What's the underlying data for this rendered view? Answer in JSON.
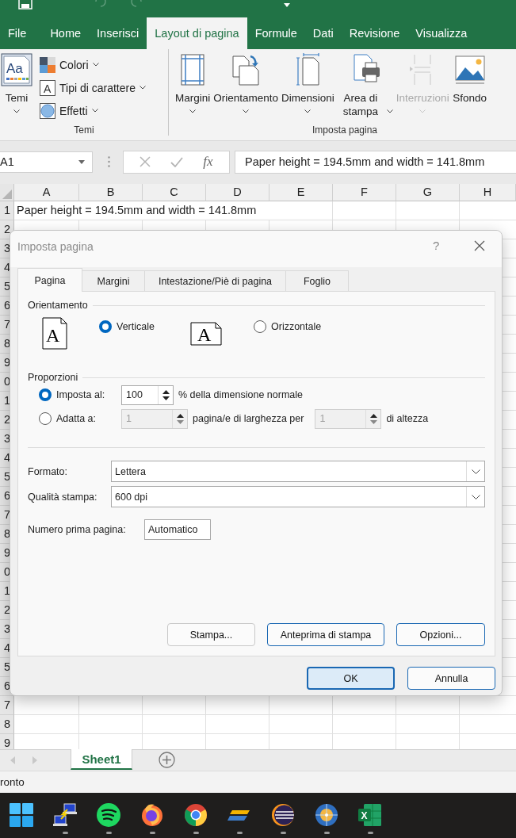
{
  "ribbon_tabs": [
    {
      "label": "File",
      "selected": false
    },
    {
      "label": "Home",
      "selected": false
    },
    {
      "label": "Inserisci",
      "selected": false
    },
    {
      "label": "Layout di pagina",
      "selected": true
    },
    {
      "label": "Formule",
      "selected": false
    },
    {
      "label": "Dati",
      "selected": false
    },
    {
      "label": "Revisione",
      "selected": false
    },
    {
      "label": "Visualizza",
      "selected": false
    }
  ],
  "ribbon": {
    "groups": [
      {
        "label": "Temi",
        "buttons": [
          {
            "label": "Temi",
            "kind": "large",
            "dropdown": true,
            "disabled": false,
            "glyph": "Aa"
          },
          {
            "label": "Colori",
            "kind": "small",
            "dropdown": true,
            "disabled": false
          },
          {
            "label": "Tipi di carattere",
            "kind": "small",
            "dropdown": true,
            "disabled": false,
            "glyph": "A"
          },
          {
            "label": "Effetti",
            "kind": "small",
            "dropdown": true,
            "disabled": false
          }
        ]
      },
      {
        "label": "Imposta pagina",
        "buttons": [
          {
            "label": "Margini",
            "kind": "large",
            "dropdown": true,
            "disabled": false
          },
          {
            "label": "Orientamento",
            "kind": "large",
            "dropdown": true,
            "disabled": false
          },
          {
            "label": "Dimensioni",
            "kind": "large",
            "dropdown": true,
            "disabled": false
          },
          {
            "label": "Area di stampa",
            "kind": "wrapped",
            "dropdown": true,
            "disabled": false
          },
          {
            "label": "Interruzioni",
            "kind": "large",
            "dropdown": true,
            "disabled": true
          },
          {
            "label": "Sfondo",
            "kind": "large",
            "dropdown": false,
            "disabled": false
          }
        ]
      }
    ]
  },
  "formula_bar": {
    "name_box": "A1",
    "function_glyph": "fx",
    "formula": "Paper height = 194.5mm and width = 141.8mm"
  },
  "sheet": {
    "columns": [
      "A",
      "B",
      "C",
      "D",
      "E",
      "F",
      "G",
      "H"
    ],
    "rows": [
      {
        "header": "1",
        "text": "Paper height = 194.5mm and width = 141.8mm"
      },
      {
        "header": "2"
      },
      {
        "header": "3"
      },
      {
        "header": "4"
      },
      {
        "header": "5"
      },
      {
        "header": "6"
      },
      {
        "header": "7"
      },
      {
        "header": "8"
      },
      {
        "header": "9"
      },
      {
        "header": "0"
      },
      {
        "header": "1"
      },
      {
        "header": "2"
      },
      {
        "header": "3"
      },
      {
        "header": "4"
      },
      {
        "header": "5"
      },
      {
        "header": "6"
      },
      {
        "header": "7"
      },
      {
        "header": "8"
      },
      {
        "header": "9"
      },
      {
        "header": "0"
      },
      {
        "header": "1"
      },
      {
        "header": "2"
      },
      {
        "header": "3"
      },
      {
        "header": "4"
      },
      {
        "header": "5"
      },
      {
        "header": "6"
      },
      {
        "header": "7"
      },
      {
        "header": "8"
      },
      {
        "header": "9"
      }
    ]
  },
  "dialog": {
    "title": "Imposta pagina",
    "help": "?",
    "tabs": [
      {
        "label": "Pagina",
        "selected": true
      },
      {
        "label": "Margini",
        "selected": false
      },
      {
        "label": "Intestazione/Piè di pagina",
        "selected": false
      },
      {
        "label": "Foglio",
        "selected": false
      }
    ],
    "orientation": {
      "label": "Orientamento",
      "options": [
        {
          "label": "Verticale",
          "selected": true,
          "glyph": "A"
        },
        {
          "label": "Orizzontale",
          "selected": false,
          "glyph": "A"
        }
      ]
    },
    "scaling": {
      "label": "Proporzioni",
      "options": [
        {
          "label": "Imposta al:",
          "selected": true
        },
        {
          "label": "Adatta a:",
          "selected": false
        }
      ],
      "adjust_value": "100",
      "adjust_suffix": "% della dimensione normale",
      "fit_wide": "1",
      "fit_wide_suffix": "pagina/e di larghezza per",
      "fit_tall": "1",
      "fit_tall_suffix": "di altezza"
    },
    "fields": [
      {
        "label": "Formato:",
        "value": "Lettera",
        "kind": "dropdown"
      },
      {
        "label": "Qualità stampa:",
        "value": "600 dpi",
        "kind": "dropdown"
      },
      {
        "label": "Numero prima pagina:",
        "value": "Automatico",
        "kind": "text"
      }
    ],
    "panel_buttons": [
      {
        "label": "Stampa...",
        "highlighted": false
      },
      {
        "label": "Anteprima di stampa",
        "highlighted": true
      },
      {
        "label": "Opzioni...",
        "highlighted": true
      }
    ],
    "footer_buttons": [
      {
        "label": "OK",
        "default": true
      },
      {
        "label": "Annulla",
        "default": false
      }
    ]
  },
  "sheet_tabs": [
    {
      "label": "Sheet1",
      "selected": true
    }
  ],
  "status_bar": {
    "text": "ronto"
  },
  "taskbar": {
    "items": [
      {
        "kind": "start",
        "running": false
      },
      {
        "kind": "network",
        "running": true
      },
      {
        "kind": "audio",
        "running": true
      },
      {
        "kind": "fox",
        "running": true
      },
      {
        "kind": "wheel",
        "running": true
      },
      {
        "kind": "tool",
        "running": true
      },
      {
        "kind": "ide",
        "running": true
      },
      {
        "kind": "compass",
        "running": true
      },
      {
        "kind": "spreadsheet",
        "running": true,
        "glyph": "X"
      }
    ]
  }
}
